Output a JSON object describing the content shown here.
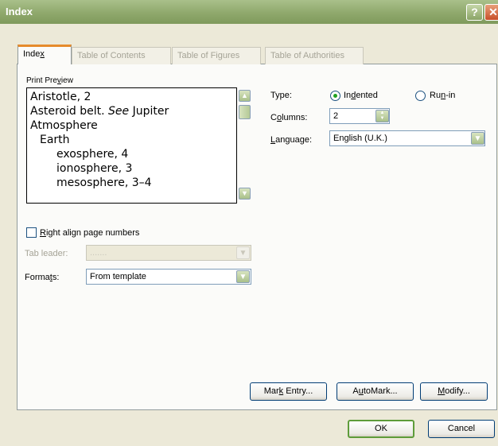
{
  "window": {
    "title": "Index",
    "help_glyph": "?",
    "close_glyph": "✕"
  },
  "tabs": [
    {
      "pre": "Inde",
      "key": "x",
      "post": ""
    },
    {
      "label": "Table of Contents"
    },
    {
      "label": "Table of Figures"
    },
    {
      "label": "Table of Authorities"
    }
  ],
  "preview": {
    "label_pre": "Print Pre",
    "label_key": "v",
    "label_post": "iew",
    "lines": [
      "Aristotle, 2",
      "Asteroid belt. ",
      "See",
      " Jupiter",
      "Atmosphere",
      "Earth",
      "exosphere, 4",
      "ionosphere, 3",
      "mesosphere, 3–4"
    ]
  },
  "type": {
    "label": "Type:",
    "indented_pre": "In",
    "indented_key": "d",
    "indented_post": "ented",
    "runin_pre": "Ru",
    "runin_key": "n",
    "runin_post": "-in",
    "selected": "Indented"
  },
  "columns": {
    "label_pre": "C",
    "label_key": "o",
    "label_post": "lumns:",
    "value": "2"
  },
  "language": {
    "label_key": "L",
    "label_post": "anguage:",
    "value": "English (U.K.)"
  },
  "right_align": {
    "label_key": "R",
    "label_post": "ight align page numbers",
    "checked": false
  },
  "tab_leader": {
    "label": "Tab leader:",
    "value": "......."
  },
  "formats": {
    "label_pre": "Forma",
    "label_key": "t",
    "label_post": "s:",
    "value": "From template"
  },
  "buttons": {
    "mark_pre": "Mar",
    "mark_key": "k",
    "mark_post": " Entry...",
    "auto_pre": "A",
    "auto_key": "u",
    "auto_post": "toMark...",
    "modify_key": "M",
    "modify_post": "odify...",
    "ok": "OK",
    "cancel": "Cancel"
  },
  "glyphs": {
    "up": "▲",
    "down": "▼",
    "dropdown": "▼"
  }
}
